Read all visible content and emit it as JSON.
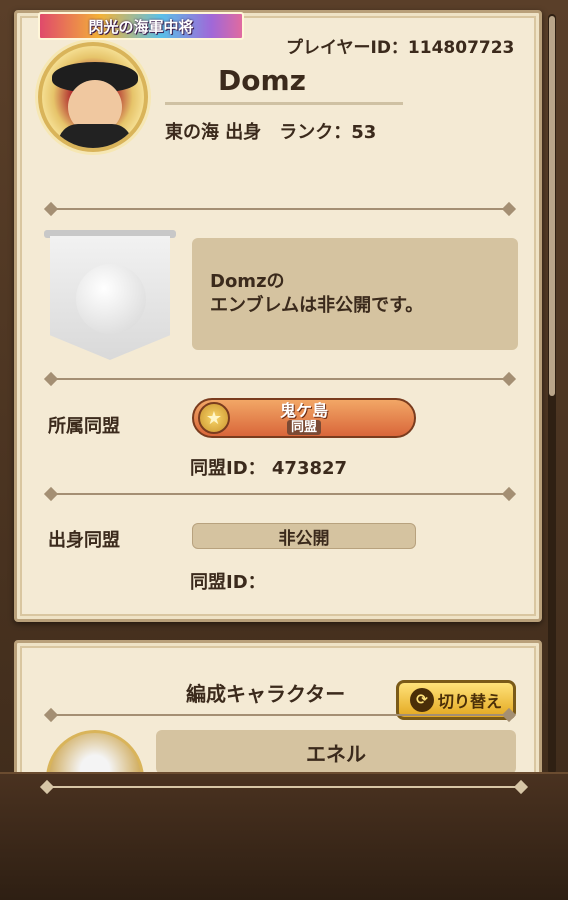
{
  "profile": {
    "title_badge": "閃光の海軍中将",
    "player_id_label": "プレイヤーID：114807723",
    "name": "Domz",
    "origin_rank": "東の海 出身　ランク：53"
  },
  "emblem": {
    "message_line1": "Domzの",
    "message_line2": "エンブレムは非公開です。"
  },
  "alliance": {
    "label": "所属同盟",
    "name": "鬼ケ島",
    "tag": "同盟",
    "id_text": "同盟ID： 473827"
  },
  "origin_alliance": {
    "label": "出身同盟",
    "status": "非公開",
    "id_text": "同盟ID："
  },
  "formation": {
    "title": "編成キャラクター",
    "switch_label": "切り替え",
    "character_name": "エネル"
  },
  "colors": {
    "card_bg": "#f4ead4",
    "panel_bg": "#d5c3a0",
    "frame": "#4a3524",
    "alliance_orange": "#e27a45",
    "button_yellow": "#f2c540"
  },
  "icons": {
    "star": "★",
    "switch": "⟳"
  }
}
